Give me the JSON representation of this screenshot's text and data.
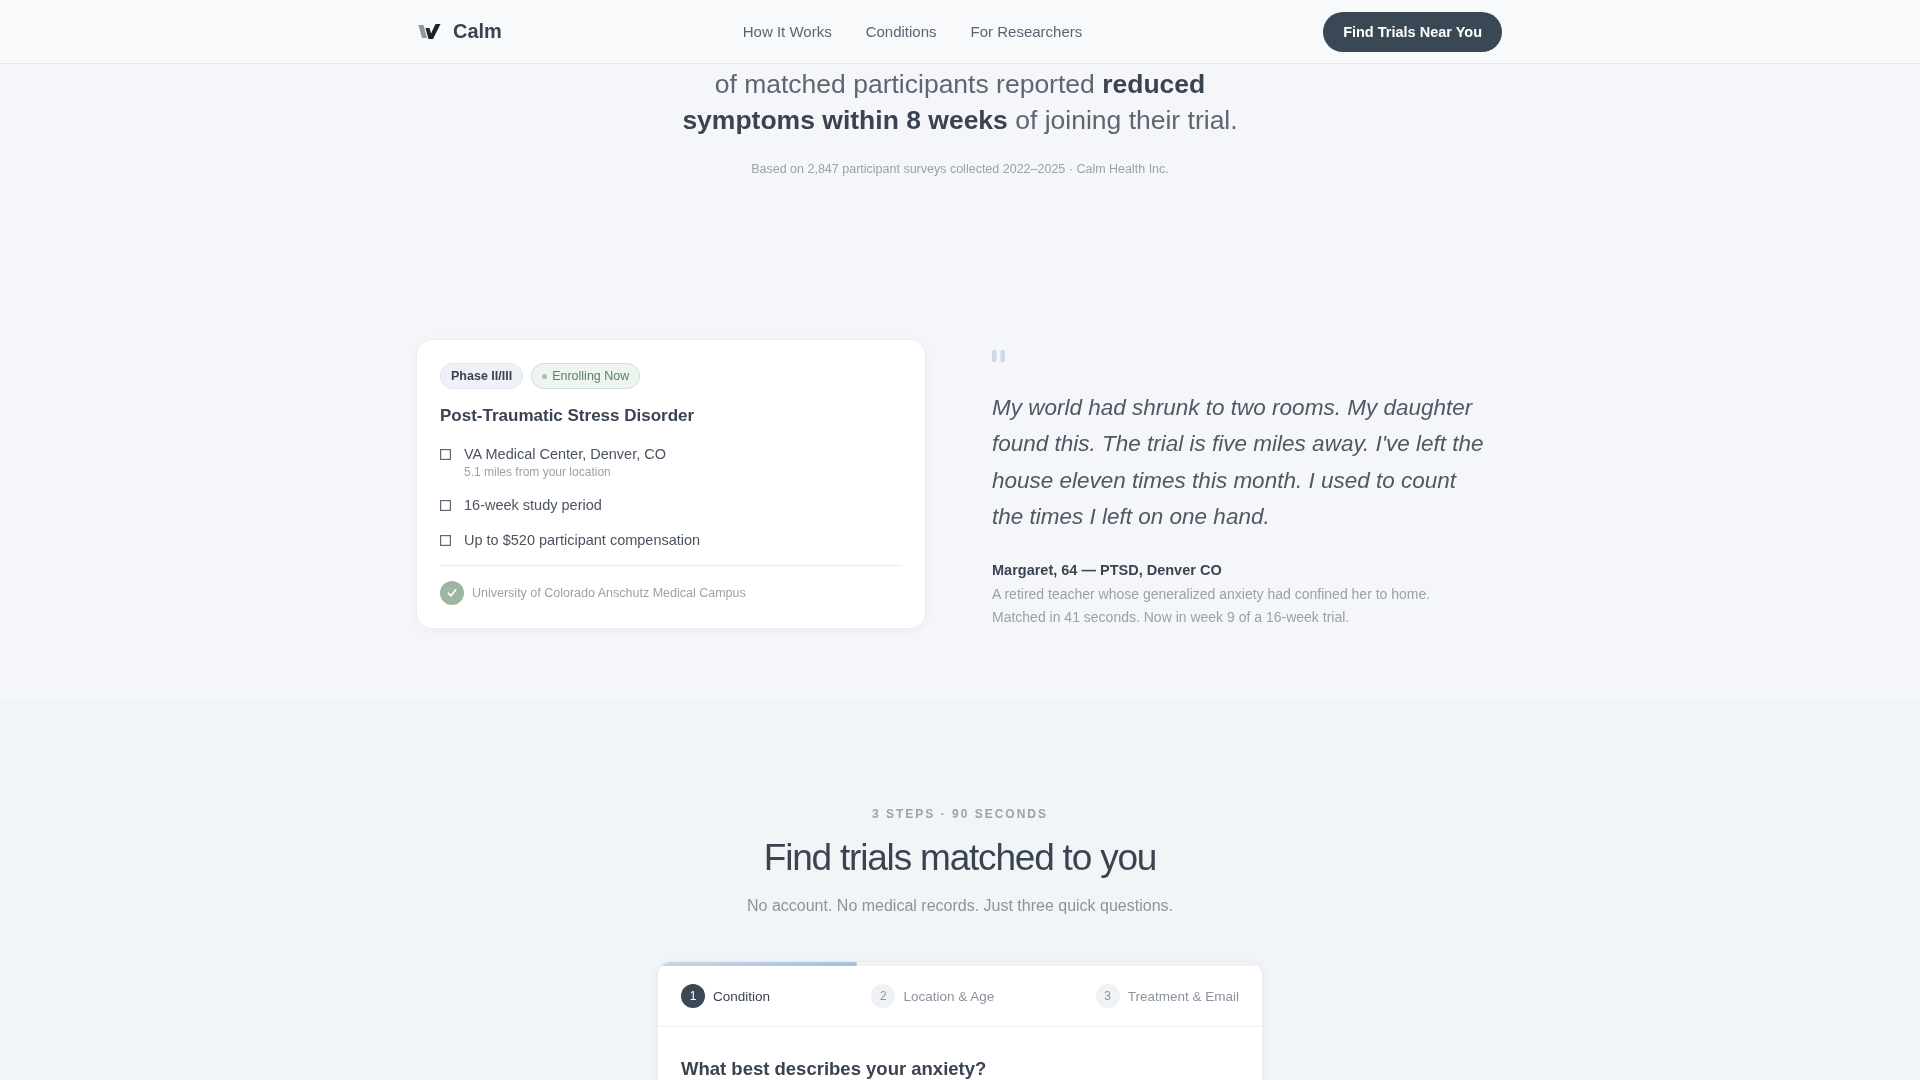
{
  "nav": {
    "brand": "Calm",
    "links": [
      "How It Works",
      "Conditions",
      "For Researchers"
    ],
    "cta": "Find Trials Near You"
  },
  "stat": {
    "text": "of matched participants reported **reduced symptoms within 8 weeks** of joining their trial.",
    "source": "Based on 2,847 participant surveys collected 2022–2025 · Calm Health Inc."
  },
  "trial_card": {
    "badges": [
      {
        "kind": "phase",
        "label": "Phase II/III"
      },
      {
        "kind": "status",
        "label": "Enrolling Now"
      }
    ],
    "title": "Post-Traumatic Stress Disorder",
    "details": [
      {
        "text": "VA Medical Center, Denver, CO",
        "note": "5.1 miles from your location"
      },
      {
        "text": "16-week study period"
      },
      {
        "text": "Up to $520 participant compensation"
      }
    ],
    "sponsor": "University of Colorado Anschutz Medical Campus"
  },
  "testimonial": {
    "quote": "My world had shrunk to two rooms. My daughter found this. The trial is five miles away. I've left the house eleven times this month. I used to count the times I left on one hand.",
    "author": "Margaret, 64 — PTSD, Denver CO",
    "bio": "A retired teacher whose generalized anxiety had confined her to home. Matched in 41 seconds. Now in week 9 of a 16-week trial."
  },
  "matcher": {
    "eyebrow": "3 STEPS · 90 SECONDS",
    "title": "Find trials matched to you",
    "subtitle": "No account. No medical records. Just three quick questions.",
    "progress": {
      "level": 0.33
    },
    "steps": [
      {
        "number": "1",
        "label": "Condition",
        "selected": true
      },
      {
        "number": "2",
        "label": "Location & Age",
        "selected": false
      },
      {
        "number": "3",
        "label": "Treatment & Email",
        "selected": false
      }
    ],
    "question": "What best describes your anxiety?"
  }
}
